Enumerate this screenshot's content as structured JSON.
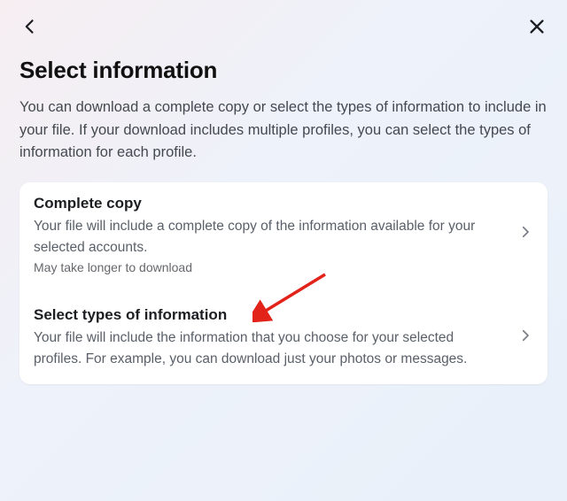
{
  "header": {
    "title": "Select information",
    "subtitle": "You can download a complete copy or select the types of information to include in your file. If your download includes multiple profiles, you can select the types of information for each profile."
  },
  "options": {
    "complete": {
      "title": "Complete copy",
      "desc": "Your file will include a complete copy of the information available for your selected accounts.",
      "note": "May take longer to download"
    },
    "select": {
      "title": "Select types of information",
      "desc": "Your file will include the information that you choose for your selected profiles. For example, you can download just your photos or messages."
    }
  }
}
